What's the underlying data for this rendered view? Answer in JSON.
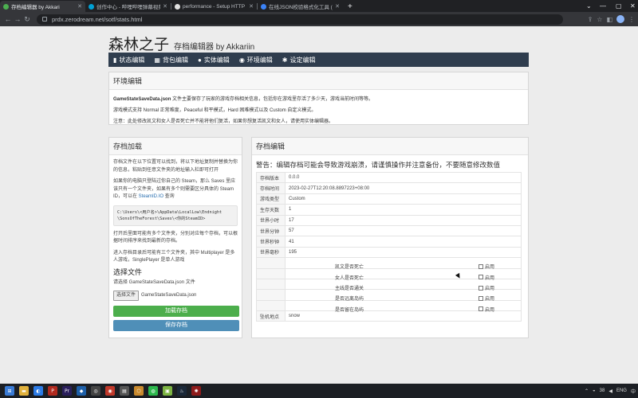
{
  "browser": {
    "tabs": [
      {
        "title": "存档编辑器 by Akkari",
        "color": "#4caf50",
        "active": true
      },
      {
        "title": "创作中心 - 哔哩哔哩弹幕视频网",
        "color": "#00a1d6",
        "active": false
      },
      {
        "title": "performance - Setup HTTP exp",
        "color": "#e0e0e0",
        "active": false
      },
      {
        "title": "在线JSON校验格式化工具 (Be",
        "color": "#3b82f6",
        "active": false
      }
    ],
    "new_tab": "+",
    "url": "prdx.zerodream.net/sotf/stats.html"
  },
  "header": {
    "title": "森林之子",
    "subtitle": "存档编辑器 by Akkariin"
  },
  "nav": {
    "items": [
      {
        "icon": "bar-chart-icon",
        "glyph": "▮",
        "label": "状态编辑"
      },
      {
        "icon": "grid-icon",
        "glyph": "▦",
        "label": "背包编辑"
      },
      {
        "icon": "user-icon",
        "glyph": "●",
        "label": "实体编辑"
      },
      {
        "icon": "globe-icon",
        "glyph": "◉",
        "label": "环境编辑"
      },
      {
        "icon": "gear-icon",
        "glyph": "✱",
        "label": "设定编辑"
      }
    ]
  },
  "env": {
    "title": "环境编辑",
    "file_name": "GameStateSaveData.json",
    "line1_rest": " 文件主要保存了玩家的游戏存档相关信息，包括你在游戏里存活了多少天，游戏当前时间等等。",
    "line2": "游戏模式支持 Normal 正常难度，Peaceful 和平模式，Hard 困难模式以及 Custom 自定义模式。",
    "line3": "注意：此处修改凯文和女人是否死亡并不能将他们复活，如果你想复活凯文和女人，请使用实体编辑器。"
  },
  "left": {
    "title": "存档加载",
    "p1": "存档文件在以下位置可以找到，将以下地址复制并替换为你的信息，粘贴到任意文件夹的地址输入栏即可打开",
    "p2a": "如果你的电脑只登陆过你自己的 Steam，那么 Saves 里应该只有一个文件夹，如果有多个则需要区分具体的 Steam ID，可以在 ",
    "p2_link": "SteamID.IO",
    "p2b": " 查询",
    "code1": "C:\\Users\\<用户名>\\AppData\\LocalLow\\Endnight",
    "code2": "\\SonsOfTheForest\\Saves\\<你的SteamID>",
    "p3": "打开后里面可能有多个文件夹，分别对应每个存档，可以根据时间排序来找到最新的存档。",
    "p4": "进入存档目录后可能有三个文件夹，其中 Multiplayer 是多人游戏，SinglePlayer 是单人游戏",
    "file_title": "选择文件",
    "file_hint": "请选择 GameStateSaveData.json 文件",
    "file_button": "选择文件",
    "file_chosen": "GameStateSaveData.json",
    "load_button": "加载存档",
    "save_button": "保存存档"
  },
  "right": {
    "title": "存档编辑",
    "warning": "警告：编辑存档可能会导致游戏崩溃，请谨慎操作并注意备份，不要随意修改数值",
    "rows": [
      {
        "key": "存档版本",
        "value": "0.0.0"
      },
      {
        "key": "存档时间",
        "value": "2023-02-27T12:20:08.8897223+08:00"
      },
      {
        "key": "游戏类型",
        "value": "Custom"
      },
      {
        "key": "生存天数",
        "value": "1"
      },
      {
        "key": "世界小时",
        "value": "17"
      },
      {
        "key": "世界分钟",
        "value": "57"
      },
      {
        "key": "世界秒钟",
        "value": "41"
      },
      {
        "key": "世界毫秒",
        "value": "195"
      }
    ],
    "checks": [
      {
        "label": "凯文是否死亡",
        "enable": "启用"
      },
      {
        "label": "女人是否死亡",
        "enable": "启用"
      },
      {
        "label": "主线是否通关",
        "enable": "启用"
      },
      {
        "label": "是否远离岛屿",
        "enable": "启用"
      },
      {
        "label": "是否留在岛屿",
        "enable": "启用"
      }
    ],
    "crash_key": "坠机地点",
    "crash_value": "snow"
  },
  "taskbar": {
    "tray_text": "ENG",
    "tray_num": "38"
  }
}
